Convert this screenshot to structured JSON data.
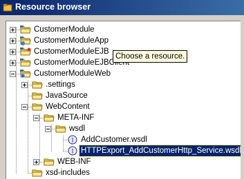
{
  "window": {
    "title": "Resource browser"
  },
  "tooltip": {
    "text": "Choose a resource."
  },
  "tree": {
    "items": [
      {
        "label": "CustomerModule",
        "state": "collapsed"
      },
      {
        "label": "CustomerModuleApp",
        "state": "collapsed"
      },
      {
        "label": "CustomerModuleEJB",
        "state": "collapsed"
      },
      {
        "label": "CustomerModuleEJBClient",
        "state": "collapsed"
      },
      {
        "label": "CustomerModuleWeb",
        "state": "expanded"
      },
      {
        "label": ".settings",
        "state": "collapsed"
      },
      {
        "label": "JavaSource",
        "state": "leaf"
      },
      {
        "label": "WebContent",
        "state": "expanded"
      },
      {
        "label": "META-INF",
        "state": "expanded"
      },
      {
        "label": "wsdl",
        "state": "expanded"
      },
      {
        "label": "AddCustomer.wsdl",
        "state": "leaf"
      },
      {
        "label": "HTTPExport_AddCustomerHttp_Service.wsdl",
        "state": "leaf",
        "selected": true
      },
      {
        "label": "WEB-INF",
        "state": "collapsed"
      },
      {
        "label": "xsd-includes",
        "state": "leaf"
      }
    ]
  },
  "colors": {
    "titlebar_start": "#0a246a",
    "titlebar_end": "#3a6ea5",
    "selection": "#0a246a",
    "tooltip_bg": "#ffffe1",
    "folder": "#f0c040"
  }
}
